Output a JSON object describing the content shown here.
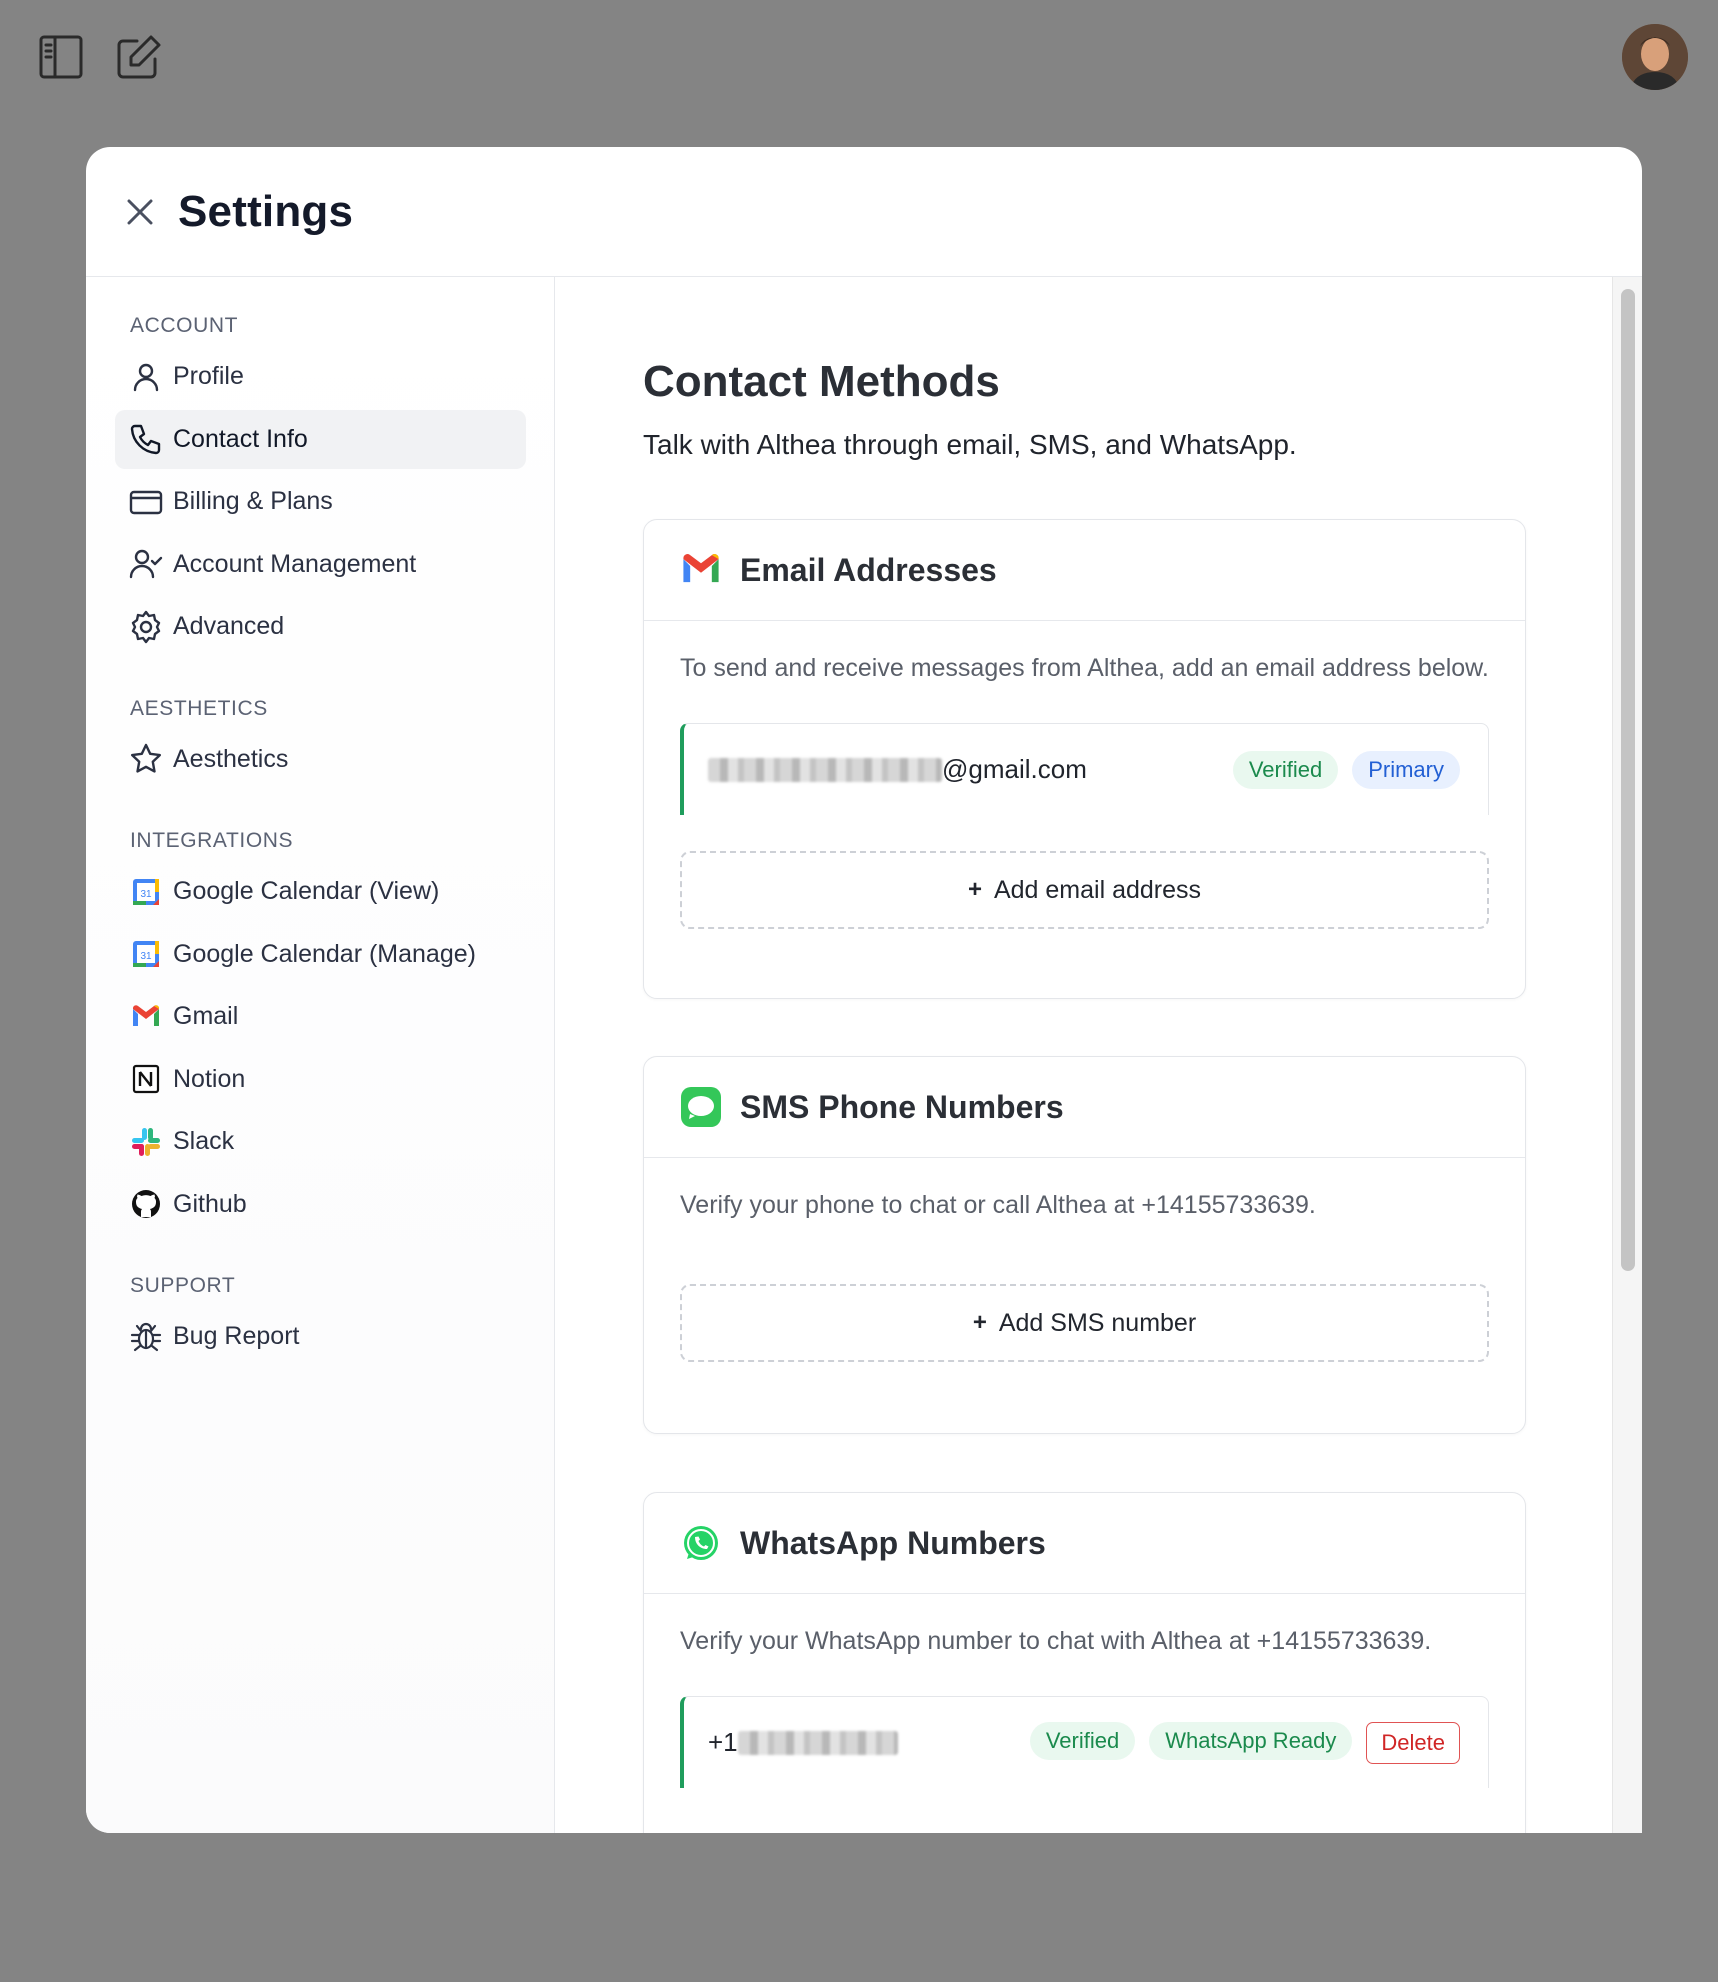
{
  "modal": {
    "title": "Settings"
  },
  "sidebar": {
    "sections": [
      {
        "label": "ACCOUNT",
        "items": [
          {
            "label": "Profile",
            "icon": "user-icon"
          },
          {
            "label": "Contact Info",
            "icon": "phone-icon",
            "active": true
          },
          {
            "label": "Billing & Plans",
            "icon": "credit-card-icon"
          },
          {
            "label": "Account Management",
            "icon": "user-check-icon"
          },
          {
            "label": "Advanced",
            "icon": "gear-icon"
          }
        ]
      },
      {
        "label": "AESTHETICS",
        "items": [
          {
            "label": "Aesthetics",
            "icon": "star-icon"
          }
        ]
      },
      {
        "label": "INTEGRATIONS",
        "items": [
          {
            "label": "Google Calendar (View)",
            "icon": "google-calendar-icon"
          },
          {
            "label": "Google Calendar (Manage)",
            "icon": "google-calendar-icon"
          },
          {
            "label": "Gmail",
            "icon": "gmail-icon"
          },
          {
            "label": "Notion",
            "icon": "notion-icon"
          },
          {
            "label": "Slack",
            "icon": "slack-icon"
          },
          {
            "label": "Github",
            "icon": "github-icon"
          }
        ]
      },
      {
        "label": "SUPPORT",
        "items": [
          {
            "label": "Bug Report",
            "icon": "bug-icon"
          }
        ]
      }
    ]
  },
  "main": {
    "title": "Contact Methods",
    "subtitle": "Talk with Althea through email, SMS, and WhatsApp.",
    "email": {
      "title": "Email Addresses",
      "description": "To send and receive messages from Althea, add an email address below.",
      "entry_suffix": "@gmail.com",
      "badge_verified": "Verified",
      "badge_primary": "Primary",
      "add_label": "Add email address"
    },
    "sms": {
      "title": "SMS Phone Numbers",
      "description": "Verify your phone to chat or call Althea at +14155733639.",
      "add_label": "Add SMS number"
    },
    "whatsapp": {
      "title": "WhatsApp Numbers",
      "description": "Verify your WhatsApp number to chat with Althea at +14155733639.",
      "entry_prefix": "+1",
      "badge_verified": "Verified",
      "badge_ready": "WhatsApp Ready",
      "delete_label": "Delete"
    }
  },
  "colors": {
    "overlay": "#848484",
    "accent_green": "#1f9d5c",
    "badge_blue": "#2360d4",
    "danger": "#d02626"
  }
}
